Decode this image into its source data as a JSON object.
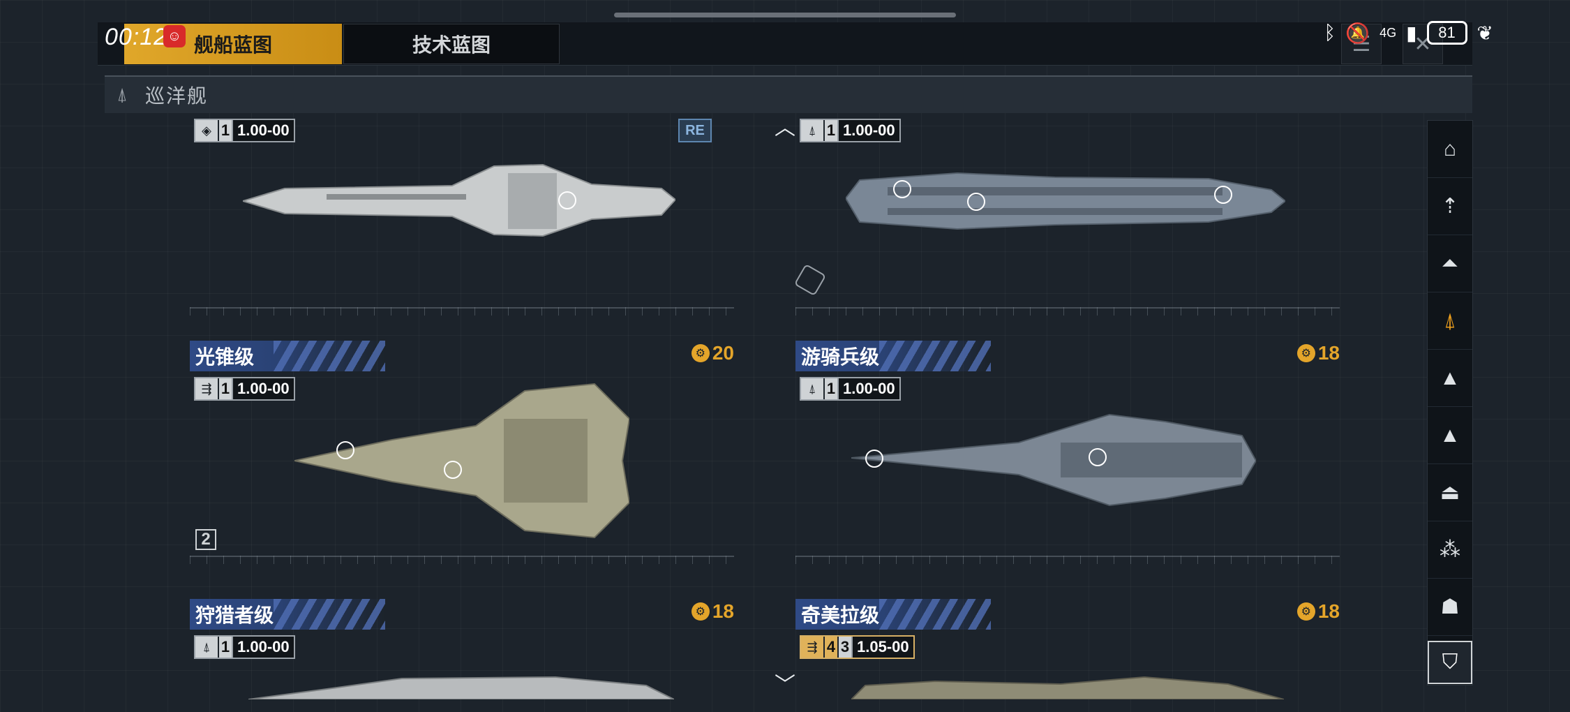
{
  "status_bar": {
    "time": "00:12",
    "network": "4G",
    "battery": "81"
  },
  "tabs": [
    {
      "label": "舰船蓝图",
      "active": true
    },
    {
      "label": "技术蓝图",
      "active": false
    }
  ],
  "category": {
    "title": "巡洋舰"
  },
  "cards": [
    {
      "name": "",
      "cost": "",
      "stat_number": "1",
      "stat_value": "1.00-00",
      "badge": "RE"
    },
    {
      "name": "",
      "cost": "",
      "stat_number": "1",
      "stat_value": "1.00-00",
      "badge": ""
    },
    {
      "name": "光锥级",
      "cost": "20",
      "stat_number": "1",
      "stat_value": "1.00-00",
      "tier": "2"
    },
    {
      "name": "游骑兵级",
      "cost": "18",
      "stat_number": "1",
      "stat_value": "1.00-00"
    },
    {
      "name": "狩猎者级",
      "cost": "18",
      "stat_number": "1",
      "stat_value": "1.00-00"
    },
    {
      "name": "奇美拉级",
      "cost": "18",
      "stat_number_a": "4",
      "stat_number": "3",
      "stat_value": "1.05-00"
    }
  ],
  "sidebar": {
    "items": [
      "cruiser-class-1-icon",
      "cruiser-class-2-icon",
      "cruiser-class-3-icon",
      "cruiser-class-4-icon",
      "cruiser-class-5-icon",
      "cruiser-class-6-icon",
      "cruiser-class-7-icon",
      "cruiser-class-8-icon",
      "cruiser-class-9-icon"
    ],
    "active_index": 3
  },
  "colors": {
    "accent": "#f0a11c",
    "banner": "#2f4a86",
    "background": "#1c232b"
  }
}
